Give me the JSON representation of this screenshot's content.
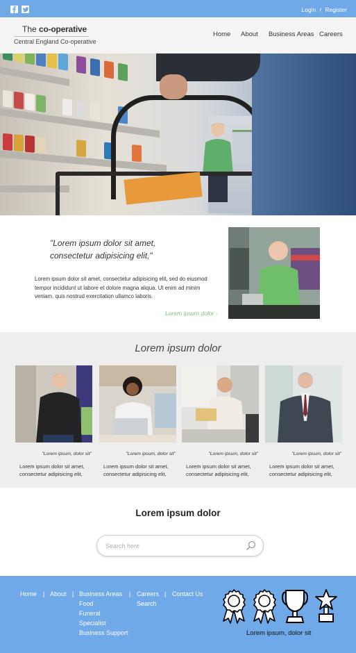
{
  "topbar": {
    "icons": [
      "facebook-icon",
      "twitter-icon"
    ],
    "login": "Login",
    "separator": "/",
    "register": "Register"
  },
  "header": {
    "logo_prefix": "The",
    "logo_name": "co-operative",
    "logo_sub": "Central England Co-operative",
    "nav": [
      "Home",
      "About",
      "Business Areas",
      "Careers"
    ]
  },
  "intro": {
    "quote": "\"Lorem ipsum dolor sit amet, consectetur adipisicing elit,\"",
    "body": "Lorem ipsum dolor sit amet, consectetur adipisicing elit, sed do eiusmod tempor incididunt ut labore et dolore magna aliqua. Ut enim ad minim veniam, quis nostrud exercitation ullamco laboris.",
    "link": "Lorem ipsum dolor -"
  },
  "team": {
    "title": "Lorem ipsum dolor",
    "cards": [
      {
        "caption": "\"Lorem ipsum, dolor sit\"",
        "text": "Lorem ipsum dolor sit amet, consectetur adipisicing elit,"
      },
      {
        "caption": "\"Lorem ipsum, dolor sit\"",
        "text": "Lorem ipsum dolor sit amet, consectetur adipisicing elit,"
      },
      {
        "caption": "\"Lorem ipsum, dolor sit\"",
        "text": "Lorem ipsum dolor sit amet, consectetur adipisicing elit,"
      },
      {
        "caption": "\"Lorem ipsum, dolor sit\"",
        "text": "Lorem ipsum dolor sit amet, consectetur adipisicing elit,"
      }
    ]
  },
  "search": {
    "title": "Lorem ipsum dolor",
    "placeholder": "Search here"
  },
  "footer": {
    "nav": [
      "Home",
      "About",
      "Business Areas",
      "Careers",
      "Contact Us"
    ],
    "separator": "|",
    "business_areas_sub": [
      "Food",
      "Funeral",
      "Specialist",
      "Business Support"
    ],
    "careers_sub": [
      "Search"
    ],
    "awards": [
      "rosette-icon",
      "rosette-icon",
      "trophy-icon",
      "star-trophy-icon"
    ],
    "awards_caption": "Lorem ipsum, dolor sit"
  },
  "colors": {
    "brand_blue": "#6fa9e8",
    "link_green": "#7ec07a",
    "section_gray": "#eeeeee",
    "header_gray": "#f5f5f5"
  }
}
